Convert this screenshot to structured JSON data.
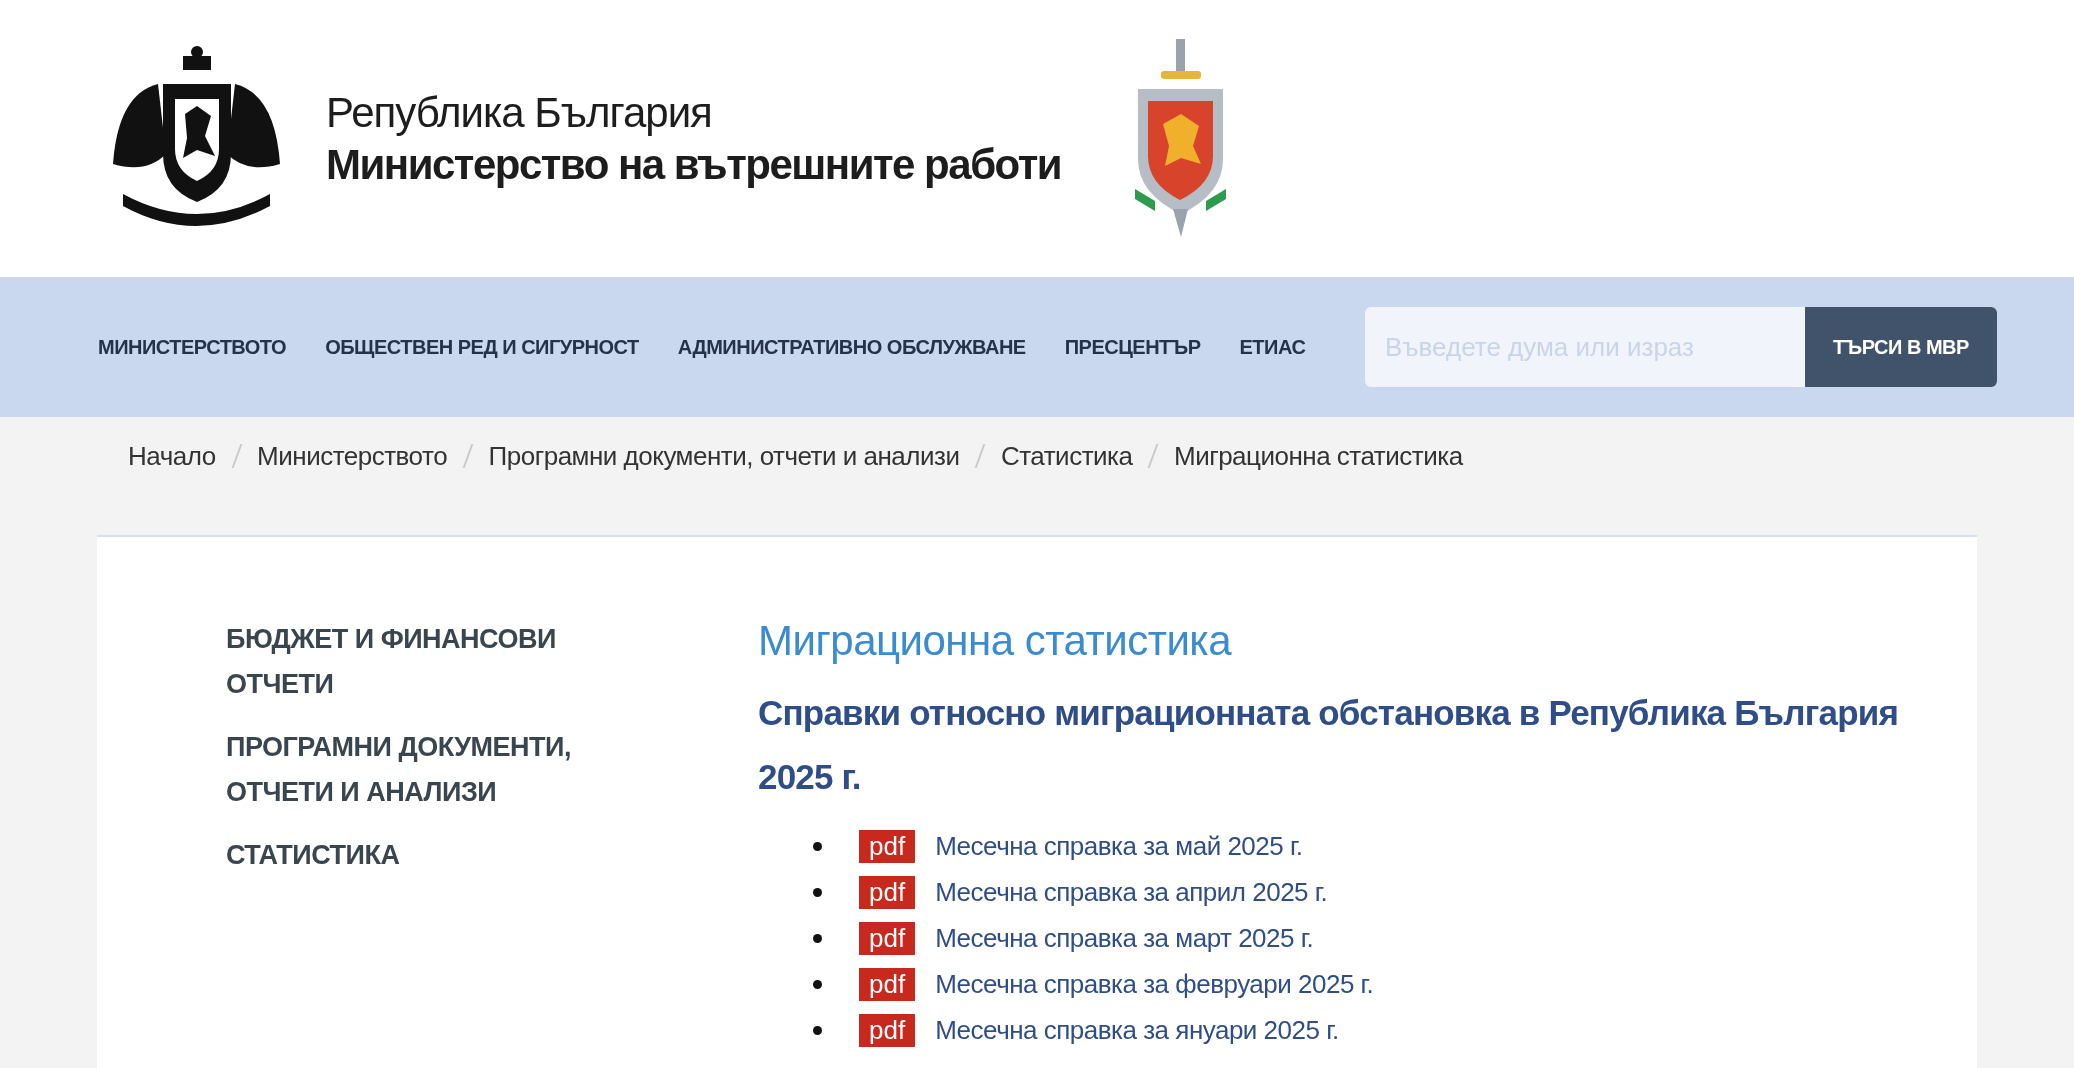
{
  "header": {
    "country": "Република България",
    "ministry": "Министерство на вътрешните работи"
  },
  "nav": {
    "items": [
      "МИНИСТЕРСТВОТО",
      "ОБЩЕСТВЕН РЕД И СИГУРНОСТ",
      "АДМИНИСТРАТИВНО ОБСЛУЖВАНЕ",
      "ПРЕСЦЕНТЪР",
      "ЕТИАС"
    ],
    "search_placeholder": "Въведете дума или израз",
    "search_button": "ТЪРСИ В МВР"
  },
  "breadcrumb": [
    "Начало",
    "Министерството",
    "Програмни документи, отчети и анализи",
    "Статистика",
    "Миграционна статистика"
  ],
  "sidebar": {
    "items": [
      "БЮДЖЕТ И ФИНАНСОВИ ОТЧЕТИ",
      "ПРОГРАМНИ ДОКУМЕНТИ, ОТЧЕТИ И АНАЛИЗИ",
      "СТАТИСТИКА"
    ]
  },
  "content": {
    "title": "Миграционна статистика",
    "subtitle": "Справки относно миграционната обстановка в Република България 2025 г.",
    "documents": [
      {
        "badge": "pdf",
        "label": "Месечна справка за май 2025 г."
      },
      {
        "badge": "pdf",
        "label": "Месечна справка за април 2025 г."
      },
      {
        "badge": "pdf",
        "label": "Месечна справка за март 2025 г."
      },
      {
        "badge": "pdf",
        "label": "Месечна справка за февруари 2025 г."
      },
      {
        "badge": "pdf",
        "label": "Месечна справка за януари 2025 г."
      }
    ]
  }
}
